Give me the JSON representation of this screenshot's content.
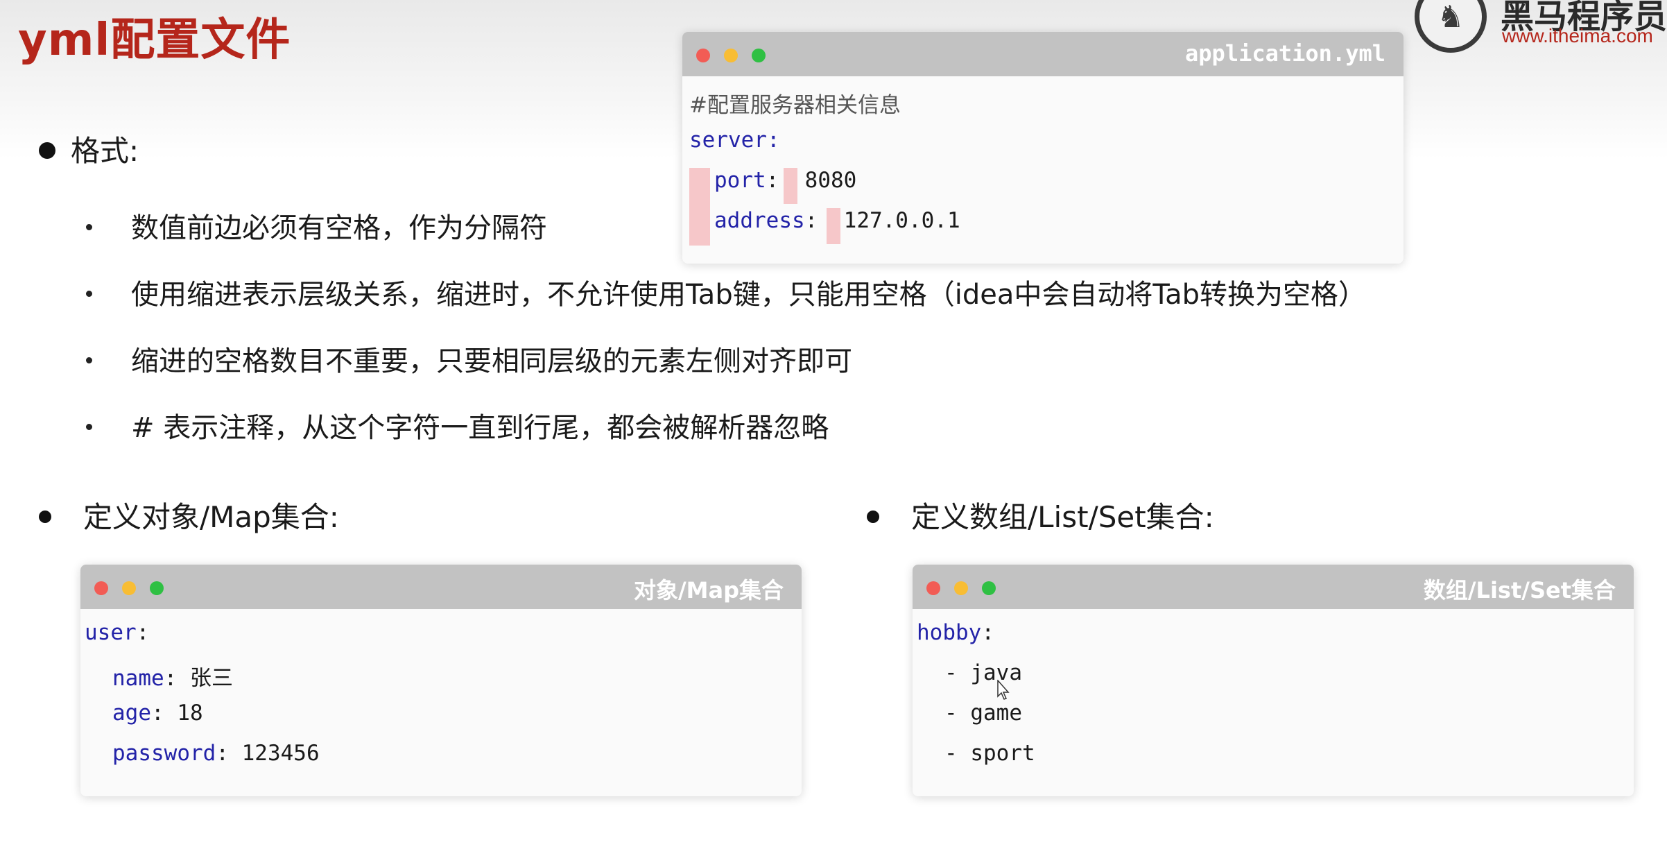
{
  "page": {
    "title": "yml配置文件"
  },
  "logo": {
    "name": "黑马程序员",
    "url": "www.itheima.com",
    "icon": "horse-logo-icon"
  },
  "format": {
    "heading": "格式:",
    "rules": [
      "数值前边必须有空格，作为分隔符",
      "使用缩进表示层级关系，缩进时，不允许使用Tab键，只能用空格（idea中会自动将Tab转换为空格）",
      "缩进的空格数目不重要，只要相同层级的元素左侧对齐即可",
      "#  表示注释，从这个字符一直到行尾，都会被解析器忽略"
    ]
  },
  "app_window": {
    "title": "application.yml",
    "comment": "#配置服务器相关信息",
    "root_key": "server",
    "port_key": "port",
    "port_value": "8080",
    "address_key": "address",
    "address_value": "127.0.0.1"
  },
  "object_section": {
    "heading": "定义对象/Map集合:",
    "window_title": "对象/Map集合",
    "root_key": "user",
    "fields": [
      {
        "key": "name",
        "value": "张三"
      },
      {
        "key": "age",
        "value": "18"
      },
      {
        "key": "password",
        "value": "123456"
      }
    ]
  },
  "list_section": {
    "heading": "定义数组/List/Set集合:",
    "window_title": "数组/List/Set集合",
    "root_key": "hobby",
    "items": [
      "java",
      "game",
      "sport"
    ]
  },
  "colors": {
    "title_red": "#b5261b",
    "key_blue": "#2323a8",
    "indent_pink": "#f6c7c9",
    "titlebar_gray": "#c2c2c2"
  }
}
